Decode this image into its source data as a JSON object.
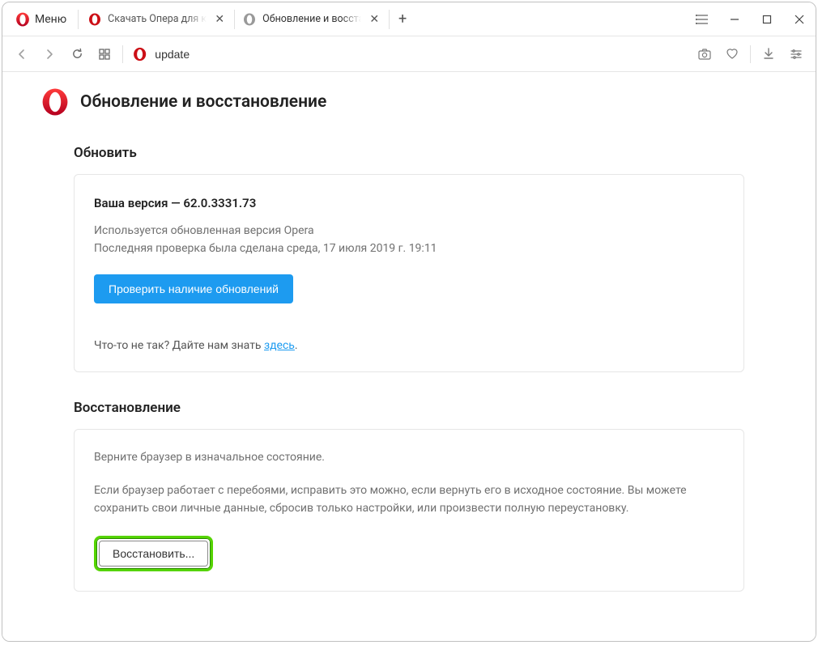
{
  "menu": {
    "label": "Меню"
  },
  "tabs": [
    {
      "label": "Скачать Опера для компь"
    },
    {
      "label": "Обновление и восстановл"
    }
  ],
  "newtab": {
    "glyph": "+"
  },
  "address": {
    "value": "update"
  },
  "page": {
    "title": "Обновление и восстановление",
    "section_update": {
      "title": "Обновить",
      "version_prefix": "Ваша версия — ",
      "version_value": "62.0.3331.73",
      "status_line": "Используется обновленная версия Opera",
      "last_check": "Последняя проверка была сделана среда, 17 июля 2019 г. 19:11",
      "check_btn": "Проверить наличие обновлений",
      "feedback_prefix": "Что-то не так? Дайте нам знать ",
      "feedback_link": "здесь",
      "feedback_suffix": "."
    },
    "section_restore": {
      "title": "Восстановление",
      "lead": "Верните браузер в изначальное состояние.",
      "body": "Если браузер работает с перебоями, исправить это можно, если вернуть его в исходное состояние. Вы можете сохранить свои личные данные, сбросив только настройки, или произвести полную переустановку.",
      "restore_btn": "Восстановить..."
    }
  }
}
